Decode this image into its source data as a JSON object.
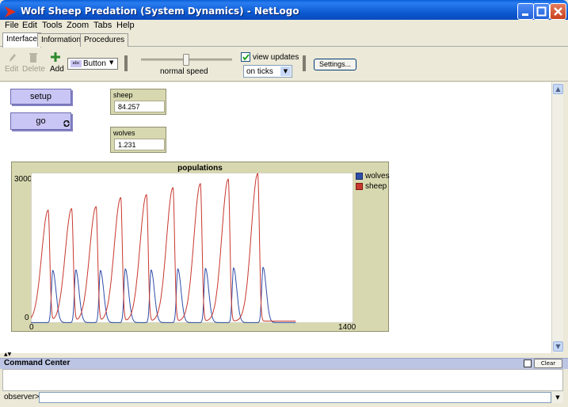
{
  "window": {
    "title": "Wolf Sheep Predation (System Dynamics) - NetLogo"
  },
  "menu": [
    "File",
    "Edit",
    "Tools",
    "Zoom",
    "Tabs",
    "Help"
  ],
  "tabs": [
    "Interface",
    "Information",
    "Procedures"
  ],
  "toolbar": {
    "edit": "Edit",
    "delete": "Delete",
    "add": "Add",
    "widget_type": "Button",
    "widget_type_icon": "abc",
    "speed_label": "normal speed",
    "view_updates": "view updates",
    "view_updates_checked": true,
    "update_mode": "on ticks",
    "settings": "Settings..."
  },
  "widgets": {
    "setup": "setup",
    "go": "go",
    "sheep_monitor": {
      "label": "sheep",
      "value": "84.257"
    },
    "wolves_monitor": {
      "label": "wolves",
      "value": "1.231"
    }
  },
  "plot": {
    "title": "populations",
    "ymax_label": "3000",
    "ymin_label": "0",
    "xmin_label": "0",
    "xmax_label": "1400"
  },
  "chart_data": {
    "type": "line",
    "title": "populations",
    "xlim": [
      0,
      1400
    ],
    "ylim": [
      0,
      3000
    ],
    "legend_position": "right",
    "series": [
      {
        "name": "wolves",
        "color": "#2f4ea8",
        "model": "pulse",
        "baseline": 10,
        "rise": 6,
        "decay": 14,
        "start": 0,
        "end": 1150,
        "peaks": [
          [
            95,
            1050
          ],
          [
            195,
            1060
          ],
          [
            302,
            1050
          ],
          [
            410,
            1080
          ],
          [
            522,
            1060
          ],
          [
            638,
            1080
          ],
          [
            758,
            1090
          ],
          [
            880,
            1100
          ],
          [
            1008,
            1110
          ]
        ]
      },
      {
        "name": "sheep",
        "color": "#c8372d",
        "model": "pulse",
        "baseline": 40,
        "rise": 28,
        "decay": 7,
        "start": 0,
        "end": 1150,
        "peaks": [
          [
            75,
            2250
          ],
          [
            177,
            2280
          ],
          [
            283,
            2320
          ],
          [
            390,
            2500
          ],
          [
            502,
            2560
          ],
          [
            617,
            2700
          ],
          [
            736,
            2780
          ],
          [
            857,
            2870
          ],
          [
            985,
            2980
          ]
        ]
      }
    ]
  },
  "command_center": {
    "title": "Command Center",
    "clear": "Clear",
    "prompt": "observer>",
    "input": ""
  }
}
